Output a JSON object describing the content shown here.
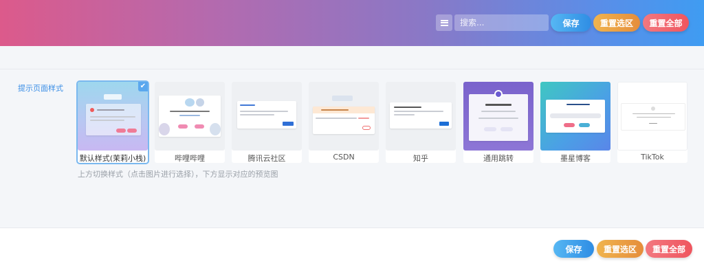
{
  "header": {
    "search_placeholder": "搜索...",
    "save_label": "保存",
    "reset_selection_label": "重置选区",
    "reset_all_label": "重置全部"
  },
  "section": {
    "label": "提示页面样式",
    "hint": "上方切换样式（点击图片进行选择），下方显示对应的预览图"
  },
  "styles": [
    {
      "caption": "默认样式(茉莉小栈)",
      "selected": true
    },
    {
      "caption": "哔哩哔哩",
      "selected": false
    },
    {
      "caption": "腾讯云社区",
      "selected": false
    },
    {
      "caption": "CSDN",
      "selected": false
    },
    {
      "caption": "知乎",
      "selected": false
    },
    {
      "caption": "通用跳转",
      "selected": false
    },
    {
      "caption": "墨星博客",
      "selected": false
    },
    {
      "caption": "TikTok",
      "selected": false
    }
  ],
  "footer": {
    "save_label": "保存",
    "reset_selection_label": "重置选区",
    "reset_all_label": "重置全部"
  },
  "colors": {
    "accent": "#3a8ee6",
    "save": "#2f8de4",
    "reset_selection": "#e58d3b",
    "reset_all": "#ef555e"
  }
}
